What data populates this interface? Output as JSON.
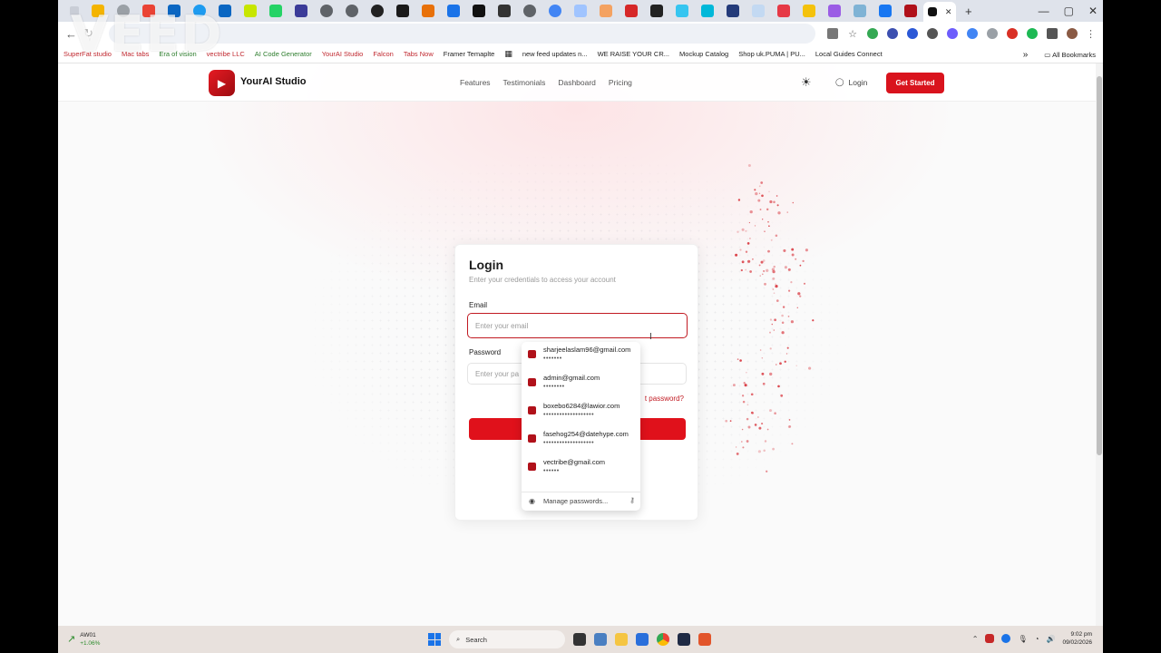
{
  "watermark": "VEED",
  "browser": {
    "tab_close": "✕",
    "new_tab": "+",
    "window_controls": [
      "—",
      "▢",
      "✕"
    ],
    "bookmarks": [
      {
        "label": "SuperFat studio",
        "style": "red"
      },
      {
        "label": "Mac tabs",
        "style": "red"
      },
      {
        "label": "Era of vision",
        "style": "grn"
      },
      {
        "label": "vectribe LLC",
        "style": "red"
      },
      {
        "label": "AI Code Generator",
        "style": "grn"
      },
      {
        "label": "YourAI Studio",
        "style": "red"
      },
      {
        "label": "Falcon",
        "style": "red"
      },
      {
        "label": "Tabs Now",
        "style": "red"
      },
      {
        "label": "Framer Temaplte",
        "style": ""
      },
      {
        "label": "new feed updates n...",
        "style": ""
      },
      {
        "label": "WE RAISE YOUR CR...",
        "style": ""
      },
      {
        "label": "Mockup Catalog",
        "style": ""
      },
      {
        "label": "Shop uk.PUMA | PU...",
        "style": ""
      },
      {
        "label": "Local Guides Connect",
        "style": ""
      }
    ],
    "bookmarks_more": "»",
    "all_bookmarks": "All Bookmarks"
  },
  "site": {
    "brand": "YourAI Studio",
    "nav_links": [
      "Features",
      "Testimonials",
      "Dashboard",
      "Pricing"
    ],
    "login_label": "Login",
    "cta_label": "Get Started"
  },
  "login_card": {
    "title": "Login",
    "subtitle": "Enter your credentials to access your account",
    "email_label": "Email",
    "email_placeholder": "Enter your email",
    "password_label": "Password",
    "password_placeholder": "Enter your pa",
    "forgot_label": "t password?"
  },
  "autofill": {
    "accounts": [
      {
        "email": "sharjeelaslam96@gmail.com",
        "mask": "•••••••"
      },
      {
        "email": "admin@gmail.com",
        "mask": "••••••••"
      },
      {
        "email": "boxebo6284@lawior.com",
        "mask": "•••••••••••••••••••"
      },
      {
        "email": "fasehog254@datehype.com",
        "mask": "•••••••••••••••••••"
      },
      {
        "email": "vectribe@gmail.com",
        "mask": "••••••"
      }
    ],
    "manage_label": "Manage passwords..."
  },
  "taskbar": {
    "weather_name": "AW01",
    "weather_change": "+1.06%",
    "search_label": "Search",
    "time": "9:02 pm",
    "date": "09/02/2026"
  },
  "colors": {
    "accent": "#d9131d",
    "brand_dark": "#9c0b10"
  }
}
